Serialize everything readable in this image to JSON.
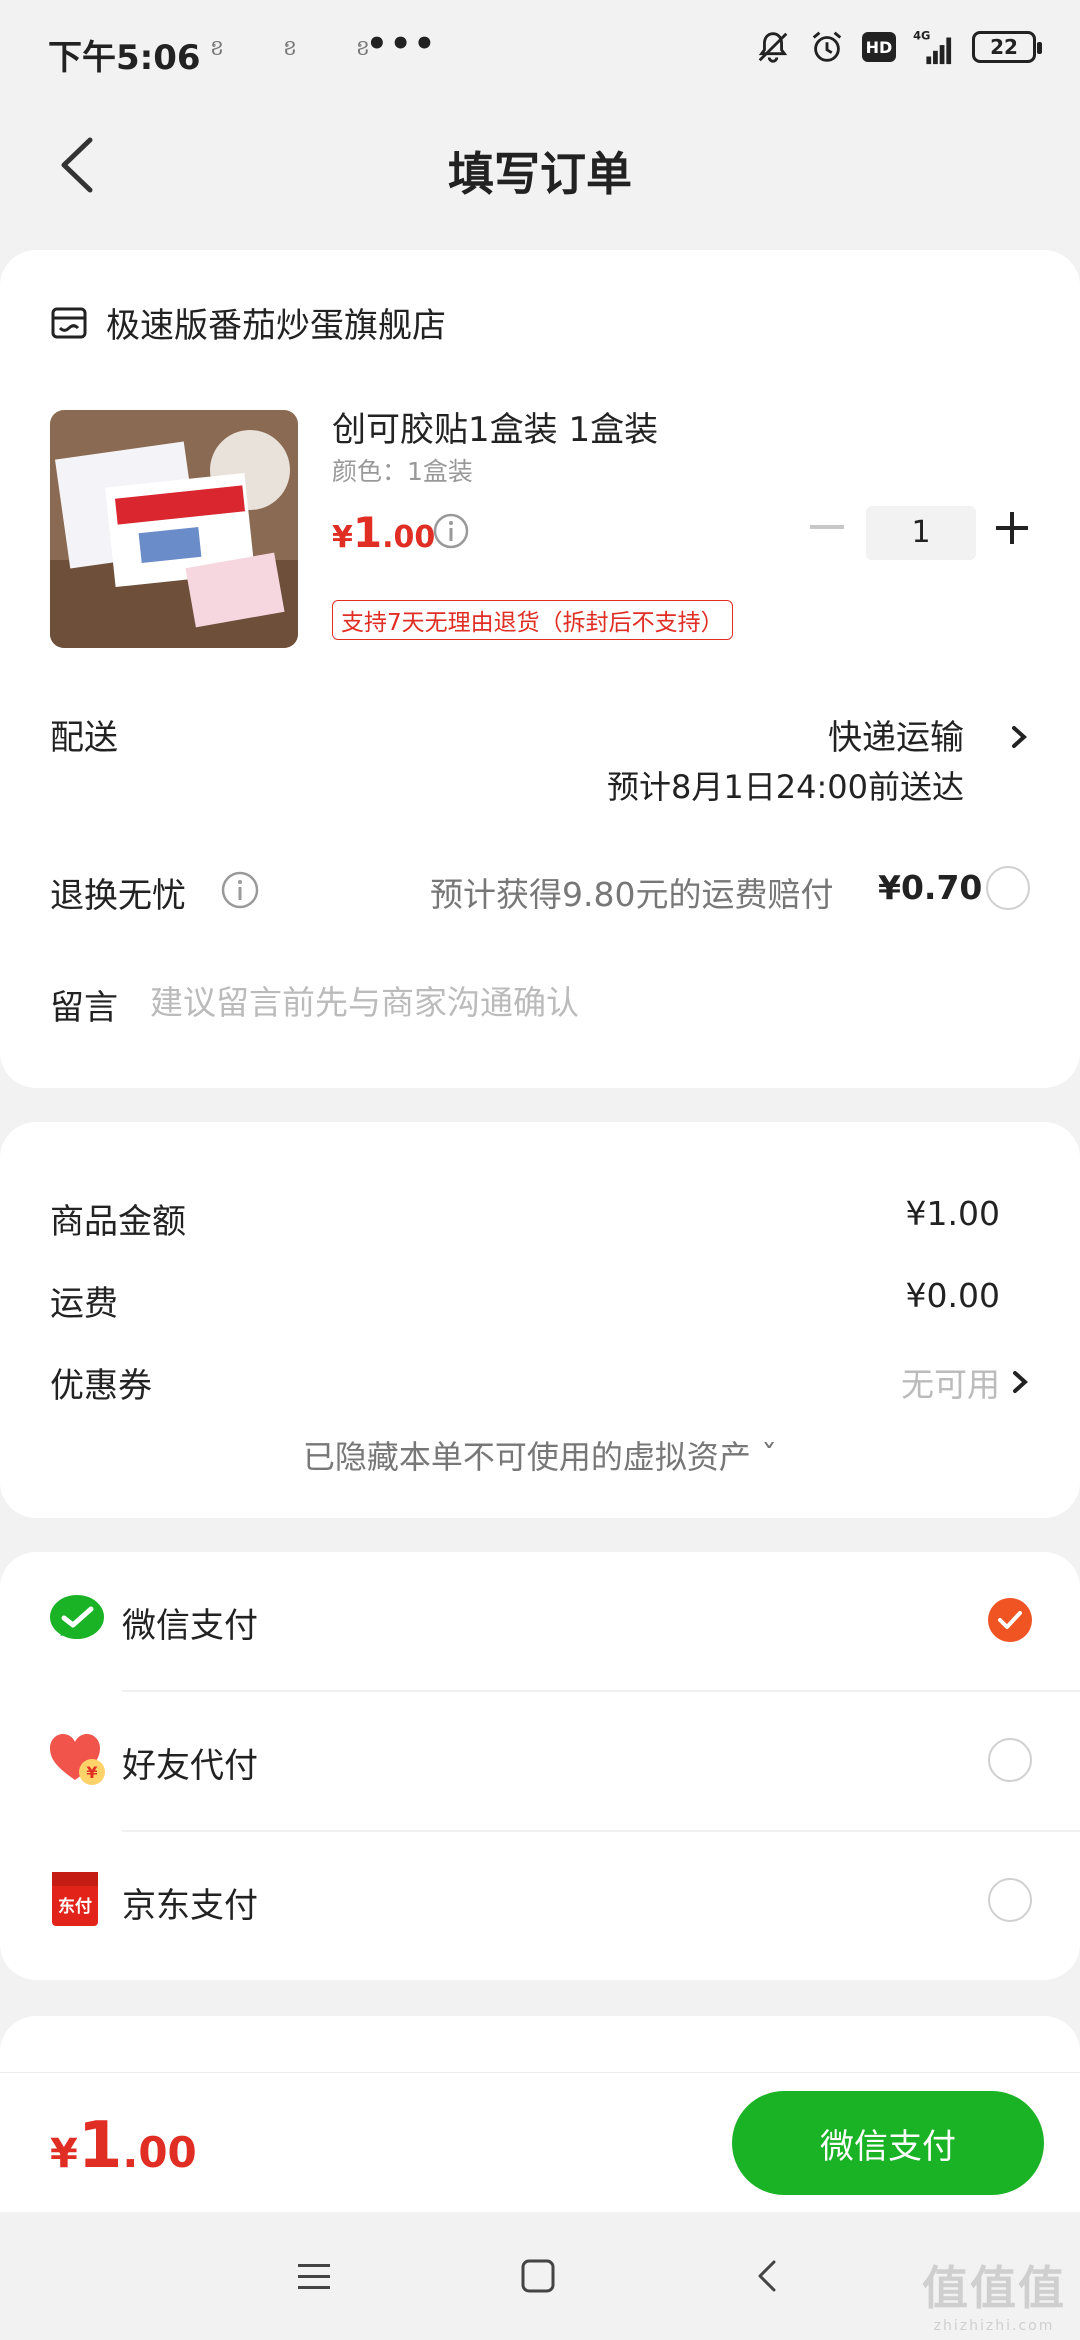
{
  "status_bar": {
    "time": "下午5:06",
    "notifications": "ខ ខ ខ",
    "more": "•••",
    "network": "4G",
    "hd": "HD",
    "battery": "22"
  },
  "nav": {
    "title": "填写订单"
  },
  "shop": {
    "name": "极速版番茄炒蛋旗舰店"
  },
  "product": {
    "title": "创可胶贴1盒装 1盒装",
    "variant": "颜色：1盒装",
    "price_currency": "¥",
    "price_integer": "1",
    "price_decimal": ".00",
    "quantity": "1",
    "return_policy": "支持7天无理由退货（拆封后不支持）"
  },
  "delivery": {
    "label": "配送",
    "method": "快递运输",
    "eta": "预计8月1日24:00前送达"
  },
  "returns": {
    "label": "退换无忧",
    "description": "预计获得9.80元的运费赔付",
    "price": "¥0.70"
  },
  "message": {
    "label": "留言",
    "placeholder": "建议留言前先与商家沟通确认"
  },
  "summary": {
    "goods_label": "商品金额",
    "goods_value": "¥1.00",
    "shipping_label": "运费",
    "shipping_value": "¥0.00",
    "coupon_label": "优惠券",
    "coupon_value": "无可用",
    "hidden_assets": "已隐藏本单不可使用的虚拟资产 ˇ"
  },
  "payment_methods": [
    {
      "label": "微信支付",
      "selected": true,
      "color": "#1ab325"
    },
    {
      "label": "好友代付",
      "selected": false,
      "color": "#f0544a"
    },
    {
      "label": "京东支付",
      "selected": false,
      "color": "#e2231a"
    }
  ],
  "friend_pay_badge": "¥",
  "jd_icon_text": "东付",
  "bottom": {
    "total_currency": "¥",
    "total_integer": "1",
    "total_decimal": ".00",
    "pay_button": "微信支付"
  },
  "watermark": {
    "big": "值值值",
    "small": "zhizhizhi.com"
  },
  "colors": {
    "accent_red": "#e02e24",
    "wechat_green": "#1ab325",
    "check_orange": "#f05423"
  }
}
